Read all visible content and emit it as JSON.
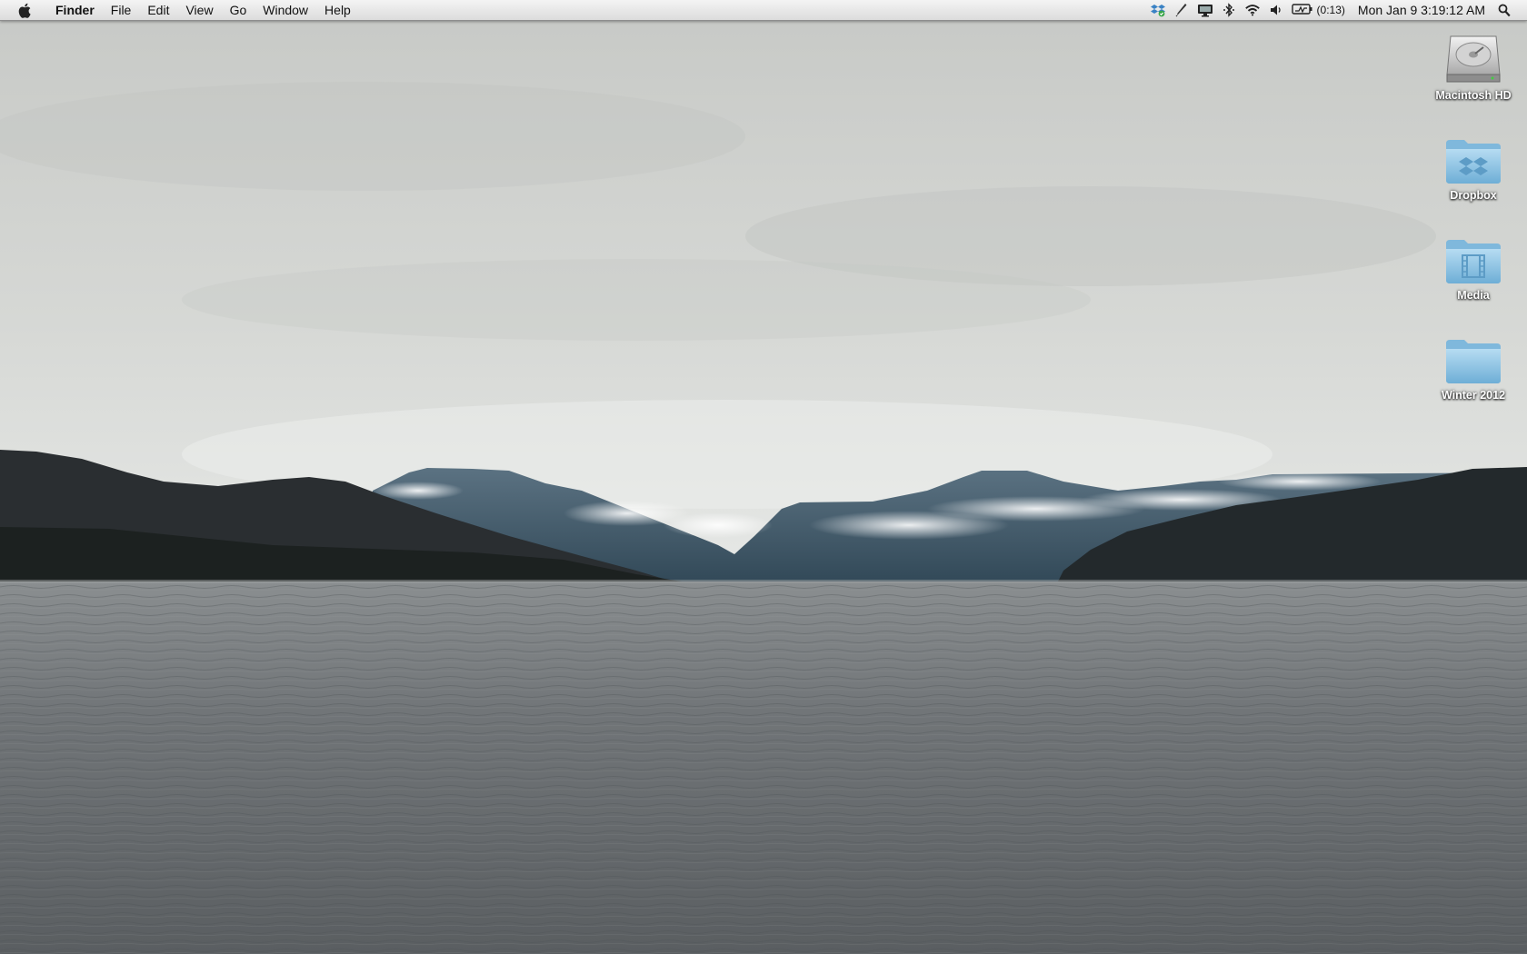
{
  "menubar": {
    "apple_icon": "apple-logo-icon",
    "app_name": "Finder",
    "menus": [
      "File",
      "Edit",
      "View",
      "Go",
      "Window",
      "Help"
    ],
    "status_icons": [
      "dropbox-sync-icon",
      "script-icon",
      "display-mirroring-icon",
      "bluetooth-icon",
      "wifi-icon",
      "volume-icon"
    ],
    "battery": {
      "icon": "battery-charging-icon",
      "time_text": "(0:13)"
    },
    "clock": "Mon Jan 9  3:19:12 AM",
    "spotlight_icon": "spotlight-search-icon"
  },
  "desktop": {
    "wallpaper": "overcast-mountain-lake",
    "icons": [
      {
        "label": "Macintosh HD",
        "icon": "hard-drive-icon"
      },
      {
        "label": "Dropbox",
        "icon": "dropbox-folder-icon"
      },
      {
        "label": "Media",
        "icon": "media-folder-icon"
      },
      {
        "label": "Winter 2012",
        "icon": "folder-icon"
      }
    ]
  },
  "colors": {
    "sky_top": "#c9cbc8",
    "sky_horizon": "#e2e4e2",
    "mountain_dark": "#22272a",
    "mountain_blue": "#3d5566",
    "water": "#6b6f72",
    "folder_blue": "#8fc6e6"
  }
}
